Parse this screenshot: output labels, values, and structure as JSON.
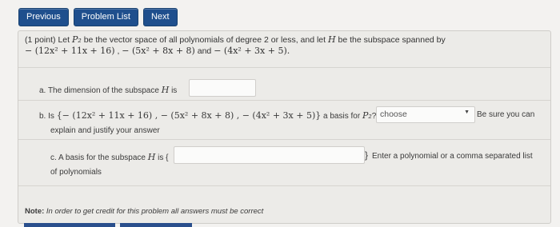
{
  "nav": {
    "previous": "Previous",
    "problem_list": "Problem List",
    "next": "Next"
  },
  "problem": {
    "points": "(1 point)",
    "intro_a": "Let",
    "space_sym": "P₂",
    "intro_b": "be the vector space of all polynomials of degree 2 or less, and let",
    "subspace_sym": "H",
    "intro_c": "be the subspace spanned by",
    "poly1": "− (12x² + 11x + 16)",
    "poly2": "− (5x² + 8x + 8)",
    "and": "and",
    "poly3": "− (4x² + 3x + 5).",
    "part_a": {
      "text": "a. The dimension of the subspace",
      "sym": "H",
      "is": "is",
      "value": ""
    },
    "part_b": {
      "prefix": "b. Is",
      "set": "{− (12x² + 11x + 16) , − (5x² + 8x + 8) , − (4x² + 3x + 5)}",
      "mid": "a basis for",
      "sym": "P₂",
      "q": "?",
      "select_value": "choose",
      "hint": "Be sure you can",
      "hint2": "explain and justify your answer"
    },
    "part_c": {
      "text": "c. A basis for the subspace",
      "sym": "H",
      "is": "is {",
      "value": "",
      "close": "}",
      "hint": "Enter a polynomial or a comma separated list",
      "hint2": "of polynomials"
    },
    "note_label": "Note:",
    "note_text": "In order to get credit for this problem all answers must be correct"
  }
}
